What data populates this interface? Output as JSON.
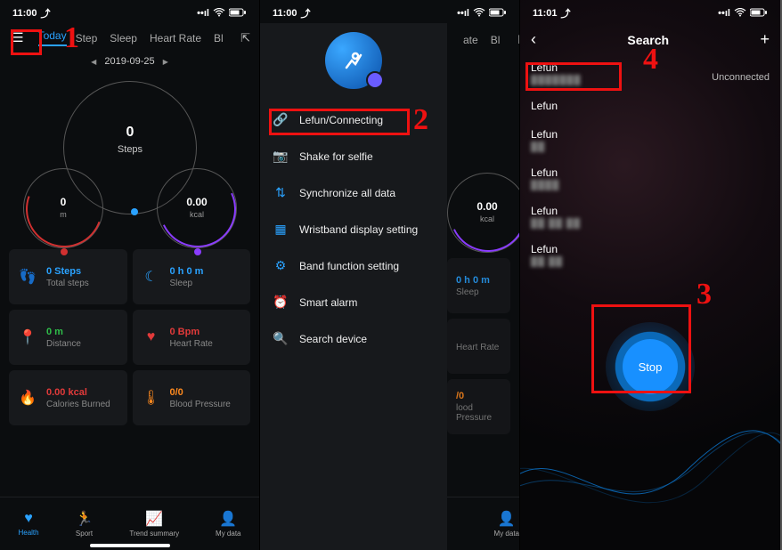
{
  "annotations": {
    "n1": "1",
    "n2": "2",
    "n3": "3",
    "n4": "4"
  },
  "phone1": {
    "status": {
      "time": "11:00",
      "arrow": "⤴",
      "signal": "▮▮▮▮",
      "wifi": "ᯤ",
      "battery": "▮▮▯"
    },
    "menu_glyph": "☰",
    "tabs": {
      "today": "Today",
      "step": "Step",
      "sleep": "Sleep",
      "hr": "Heart Rate",
      "blood": "Bl"
    },
    "share_glyph": "⇱",
    "date": {
      "prev": "◀",
      "value": "2019-09-25",
      "next": "▶"
    },
    "rings": {
      "big": {
        "value": "0",
        "label": "Steps"
      },
      "left": {
        "value": "0",
        "unit": "m"
      },
      "right": {
        "value": "0.00",
        "unit": "kcal"
      }
    },
    "cards": [
      {
        "icon": "👣",
        "icon_name": "footsteps-icon",
        "color": "c-blue",
        "value": "0 Steps",
        "label": "Total steps"
      },
      {
        "icon": "☾",
        "icon_name": "moon-icon",
        "color": "c-teal",
        "value": "0 h 0 m",
        "label": "Sleep"
      },
      {
        "icon": "📍",
        "icon_name": "pin-icon",
        "color": "c-green",
        "value": "0 m",
        "label": "Distance"
      },
      {
        "icon": "♥",
        "icon_name": "heart-icon",
        "color": "c-red",
        "value": "0 Bpm",
        "label": "Heart Rate"
      },
      {
        "icon": "🔥",
        "icon_name": "flame-icon",
        "color": "c-red",
        "value": "0.00 kcal",
        "label": "Calories Burned"
      },
      {
        "icon": "🌡",
        "icon_name": "thermometer-icon",
        "color": "c-orange",
        "value": "0/0",
        "label": "Blood Pressure"
      }
    ],
    "nav": [
      {
        "icon": "♥",
        "label": "Health",
        "active": true
      },
      {
        "icon": "🏃",
        "label": "Sport",
        "active": false
      },
      {
        "icon": "📈",
        "label": "Trend summary",
        "active": false
      },
      {
        "icon": "👤",
        "label": "My data",
        "active": false
      }
    ]
  },
  "phone2": {
    "status": {
      "time": "11:00",
      "arrow": "⤴"
    },
    "drawer": [
      {
        "icon": "🔗",
        "icon_name": "link-icon",
        "label": "Lefun/Connecting"
      },
      {
        "icon": "📷",
        "icon_name": "camera-icon",
        "label": "Shake for selfie"
      },
      {
        "icon": "⇅",
        "icon_name": "sync-icon",
        "label": "Synchronize all data"
      },
      {
        "icon": "▦",
        "icon_name": "grid-icon",
        "label": "Wristband display setting"
      },
      {
        "icon": "⚙",
        "icon_name": "gear-icon",
        "label": "Band function setting"
      },
      {
        "icon": "⏰",
        "icon_name": "alarm-icon",
        "label": "Smart alarm"
      },
      {
        "icon": "🔍",
        "icon_name": "search-icon",
        "label": "Search device"
      }
    ],
    "behind": {
      "tabs": {
        "rate": "ate",
        "blood": "Bl"
      },
      "share_glyph": "⇱",
      "right_ring": {
        "value": "0.00",
        "unit": "kcal"
      },
      "cards": [
        {
          "value": "0 h 0 m",
          "label": "Sleep"
        },
        {
          "value": "",
          "label": "Heart Rate"
        },
        {
          "value": "/0",
          "label": "lood Pressure"
        }
      ],
      "nav_mydata": "My data"
    }
  },
  "phone3": {
    "status": {
      "time": "11:01",
      "arrow": "⤴"
    },
    "back_glyph": "‹",
    "title": "Search",
    "plus_glyph": "+",
    "status_label": "Unconnected",
    "devices": [
      {
        "name": "Lefun",
        "detail": "███████"
      },
      {
        "name": "Lefun",
        "detail": ""
      },
      {
        "name": "Lefun",
        "detail": "██"
      },
      {
        "name": "Lefun",
        "detail": "████"
      },
      {
        "name": "Lefun",
        "detail": "██ ██ ██"
      },
      {
        "name": "Lefun",
        "detail": "██ ██"
      }
    ],
    "stop_label": "Stop"
  }
}
